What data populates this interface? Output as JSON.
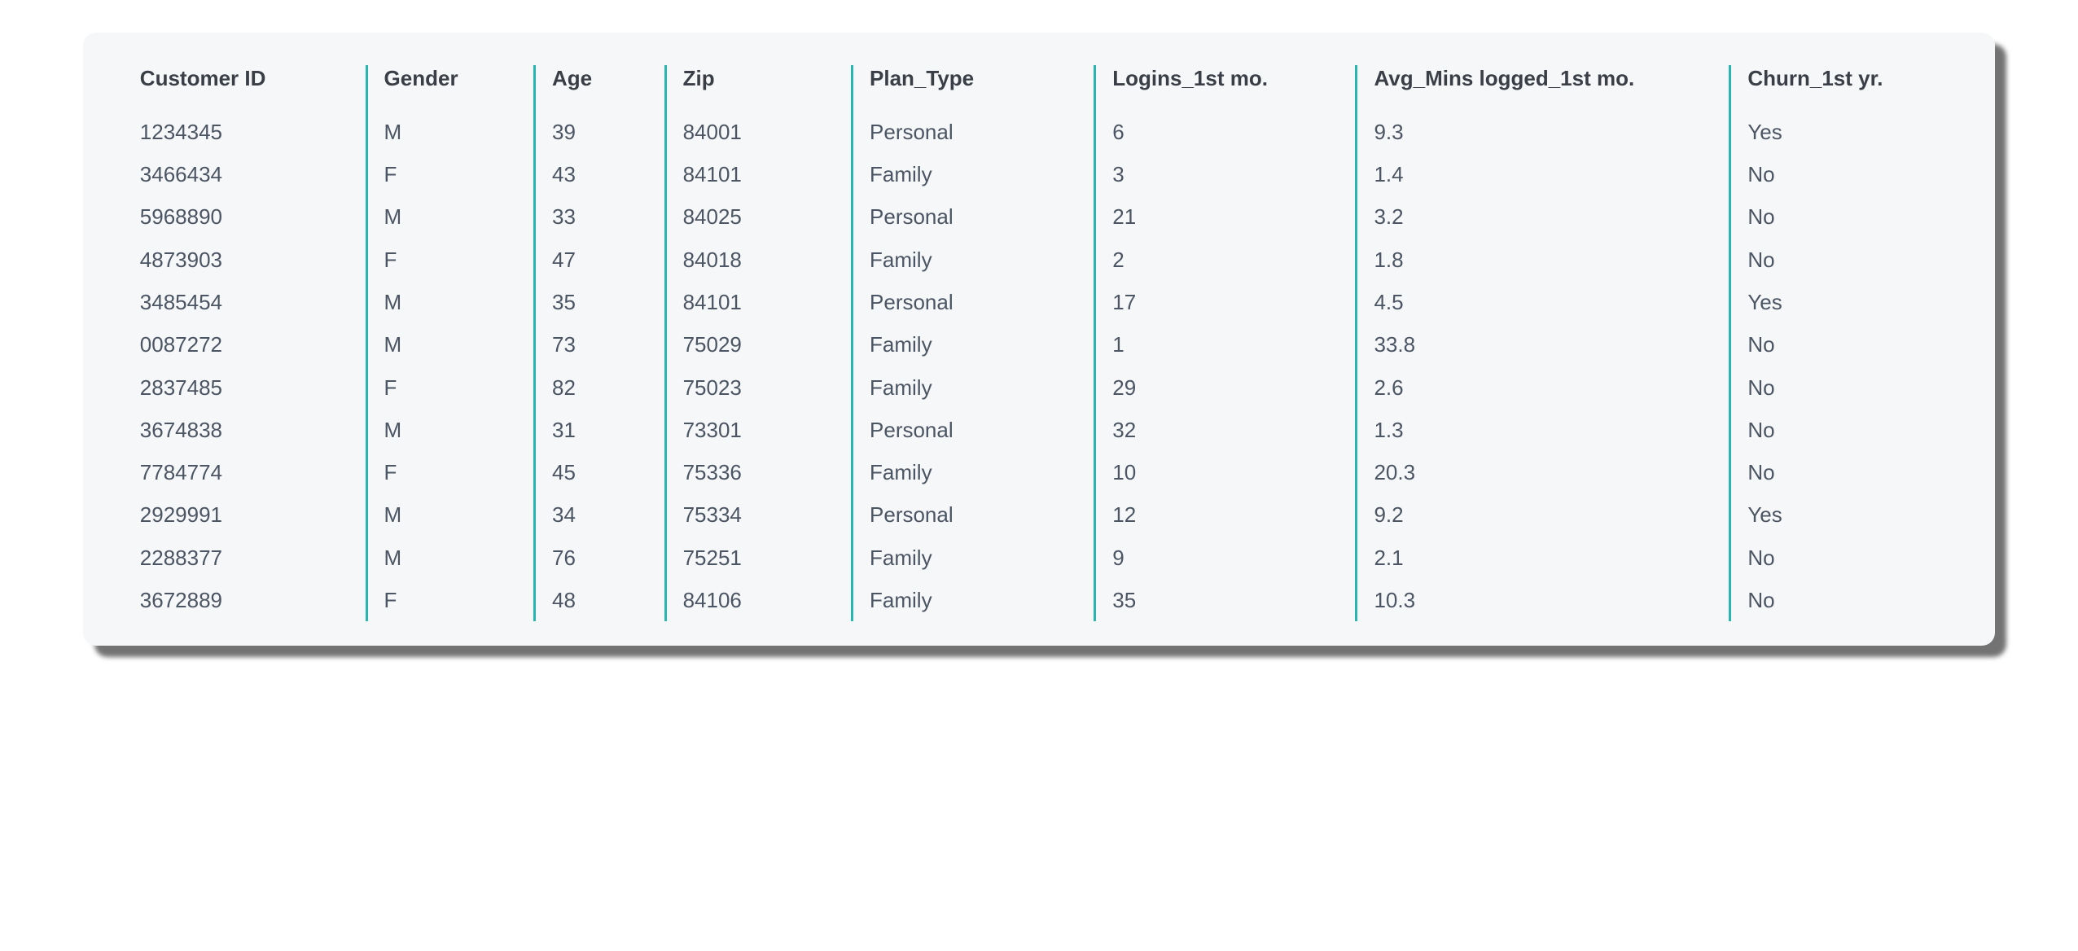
{
  "chart_data": {
    "type": "table",
    "columns": [
      "Customer ID",
      "Gender",
      "Age",
      "Zip",
      "Plan_Type",
      "Logins_1st mo.",
      "Avg_Mins logged_1st mo.",
      "Churn_1st yr."
    ],
    "rows": [
      {
        "customer_id": "1234345",
        "gender": "M",
        "age": "39",
        "zip": "84001",
        "plan_type": "Personal",
        "logins": "6",
        "avg_mins": "9.3",
        "churn": "Yes"
      },
      {
        "customer_id": "3466434",
        "gender": "F",
        "age": "43",
        "zip": "84101",
        "plan_type": "Family",
        "logins": "3",
        "avg_mins": "1.4",
        "churn": "No"
      },
      {
        "customer_id": "5968890",
        "gender": "M",
        "age": "33",
        "zip": "84025",
        "plan_type": "Personal",
        "logins": "21",
        "avg_mins": "3.2",
        "churn": "No"
      },
      {
        "customer_id": "4873903",
        "gender": "F",
        "age": "47",
        "zip": "84018",
        "plan_type": "Family",
        "logins": "2",
        "avg_mins": "1.8",
        "churn": "No"
      },
      {
        "customer_id": "3485454",
        "gender": "M",
        "age": "35",
        "zip": "84101",
        "plan_type": "Personal",
        "logins": "17",
        "avg_mins": "4.5",
        "churn": "Yes"
      },
      {
        "customer_id": "0087272",
        "gender": "M",
        "age": "73",
        "zip": "75029",
        "plan_type": "Family",
        "logins": "1",
        "avg_mins": "33.8",
        "churn": "No"
      },
      {
        "customer_id": "2837485",
        "gender": "F",
        "age": "82",
        "zip": "75023",
        "plan_type": "Family",
        "logins": "29",
        "avg_mins": "2.6",
        "churn": "No"
      },
      {
        "customer_id": "3674838",
        "gender": "M",
        "age": "31",
        "zip": "73301",
        "plan_type": "Personal",
        "logins": "32",
        "avg_mins": "1.3",
        "churn": "No"
      },
      {
        "customer_id": "7784774",
        "gender": "F",
        "age": "45",
        "zip": "75336",
        "plan_type": "Family",
        "logins": "10",
        "avg_mins": "20.3",
        "churn": "No"
      },
      {
        "customer_id": "2929991",
        "gender": "M",
        "age": "34",
        "zip": "75334",
        "plan_type": "Personal",
        "logins": "12",
        "avg_mins": "9.2",
        "churn": "Yes"
      },
      {
        "customer_id": "2288377",
        "gender": "M",
        "age": "76",
        "zip": "75251",
        "plan_type": "Family",
        "logins": "9",
        "avg_mins": "2.1",
        "churn": "No"
      },
      {
        "customer_id": "3672889",
        "gender": "F",
        "age": "48",
        "zip": "84106",
        "plan_type": "Family",
        "logins": "35",
        "avg_mins": "10.3",
        "churn": "No"
      }
    ]
  }
}
